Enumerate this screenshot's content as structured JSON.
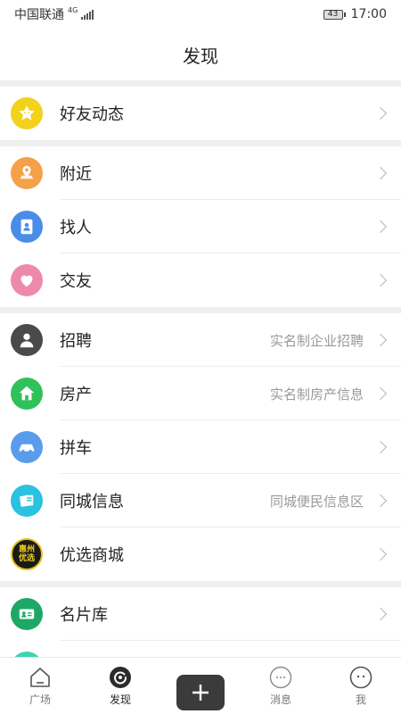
{
  "status_bar": {
    "carrier": "中国联通",
    "network": "4G",
    "battery": "43",
    "time": "17:00"
  },
  "header": {
    "title": "发现"
  },
  "groups": [
    [
      {
        "label": "好友动态",
        "sub": "",
        "icon": "star-icon",
        "color": "#f2d21b"
      }
    ],
    [
      {
        "label": "附近",
        "sub": "",
        "icon": "map-pin-icon",
        "color": "#f5a14a"
      },
      {
        "label": "找人",
        "sub": "",
        "icon": "contacts-icon",
        "color": "#4a8de8"
      },
      {
        "label": "交友",
        "sub": "",
        "icon": "heart-icon",
        "color": "#ee8aa9"
      }
    ],
    [
      {
        "label": "招聘",
        "sub": "实名制企业招聘",
        "icon": "person-icon",
        "color": "#4a4a4a"
      },
      {
        "label": "房产",
        "sub": "实名制房产信息",
        "icon": "house-icon",
        "color": "#2fc25a"
      },
      {
        "label": "拼车",
        "sub": "",
        "icon": "car-icon",
        "color": "#5b9bec"
      },
      {
        "label": "同城信息",
        "sub": "同城便民信息区",
        "icon": "cards-icon",
        "color": "#29c2e0"
      },
      {
        "label": "优选商城",
        "sub": "",
        "icon": "mall-logo",
        "color": "#1a1a1a"
      }
    ],
    [
      {
        "label": "名片库",
        "sub": "",
        "icon": "card-icon",
        "color": "#1ea866"
      },
      {
        "label": "",
        "sub": "",
        "icon": "partial-icon",
        "color": "#3ed2b6"
      }
    ]
  ],
  "mall_logo_text": [
    "惠州",
    "优选"
  ],
  "tabs": [
    {
      "label": "广场",
      "icon": "home-icon",
      "active": false
    },
    {
      "label": "发现",
      "icon": "discover-icon",
      "active": true
    },
    {
      "label": "",
      "icon": "plus-icon",
      "active": false
    },
    {
      "label": "消息",
      "icon": "message-icon",
      "active": false
    },
    {
      "label": "我",
      "icon": "profile-icon",
      "active": false
    }
  ]
}
